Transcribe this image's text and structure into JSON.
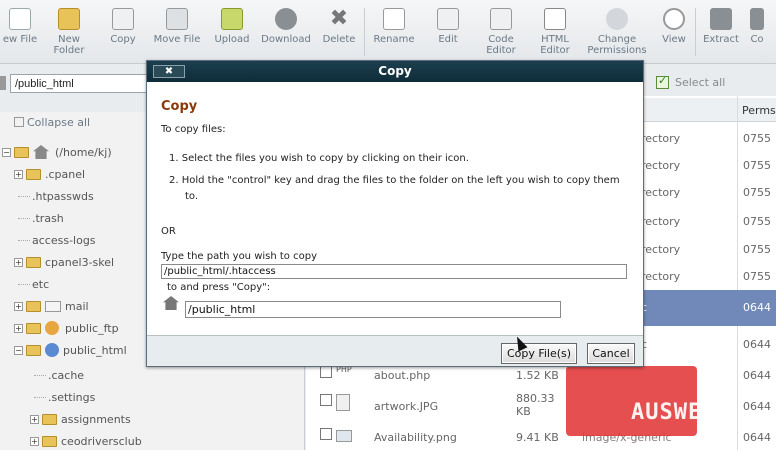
{
  "toolbar": {
    "buttons": [
      {
        "label": "ew File",
        "icon": "new-file-icon"
      },
      {
        "label": "New\nFolder",
        "icon": "new-folder-icon"
      },
      {
        "label": "Copy",
        "icon": "copy-icon"
      },
      {
        "label": "Move File",
        "icon": "move-file-icon"
      },
      {
        "label": "Upload",
        "icon": "upload-icon"
      },
      {
        "label": "Download",
        "icon": "download-icon"
      },
      {
        "label": "Delete",
        "icon": "delete-icon"
      },
      {
        "label": "Rename",
        "icon": "rename-icon"
      },
      {
        "label": "Edit",
        "icon": "edit-icon"
      },
      {
        "label": "Code\nEditor",
        "icon": "code-editor-icon"
      },
      {
        "label": "HTML\nEditor",
        "icon": "html-editor-icon"
      },
      {
        "label": "Change\nPermissions",
        "icon": "permissions-icon"
      },
      {
        "label": "View",
        "icon": "view-icon"
      },
      {
        "label": "Extract",
        "icon": "extract-icon"
      },
      {
        "label": "Co",
        "icon": "compress-icon"
      }
    ]
  },
  "path": {
    "value": "/public_html"
  },
  "select_all": {
    "label": "Select all"
  },
  "tree": {
    "collapse_all": "Collapse all",
    "root": "(/home/kj)",
    "items": [
      ".cpanel",
      ".htpasswds",
      ".trash",
      "access-logs",
      "cpanel3-skel",
      "etc",
      "mail",
      "public_ftp",
      "public_html",
      ".cache",
      ".settings",
      "assignments",
      "ceodriversclub"
    ]
  },
  "list": {
    "perms_header": "Perms",
    "rows": [
      {
        "type": "rectory",
        "perms": "0755"
      },
      {
        "type": "rectory",
        "perms": "0755"
      },
      {
        "type": "rectory",
        "perms": "0755"
      },
      {
        "type": "rectory",
        "perms": "0755"
      },
      {
        "type": "rectory",
        "perms": "0755"
      },
      {
        "type": "rectory",
        "perms": "0755"
      },
      {
        "type": "c",
        "perms": "0644"
      },
      {
        "type": "c",
        "perms": "0644"
      },
      {
        "name": "about.php",
        "size": "1.52 KB",
        "perms": "0644"
      },
      {
        "name": "artwork.JPG",
        "size": "880.33\nKB",
        "perms": "0644"
      },
      {
        "name": "Availability.png",
        "size": "9.41 KB",
        "type": "image/x-generic",
        "perms": "0644"
      }
    ]
  },
  "modal": {
    "title": "Copy",
    "close_label": "✖",
    "heading": "Copy",
    "intro": "To copy files:",
    "step1": "1.  Select the files you wish to copy by clicking on their icon.",
    "step2a": "2.  Hold the \"control\" key and drag the files to the folder on the left you wish to copy them",
    "step2b": "to.",
    "or": "OR",
    "path_label": "Type the path you wish to copy",
    "source_value": "/public_html/.htaccess",
    "press_label": "to and press \"Copy\":",
    "dest_value": "/public_html",
    "copy_button": "Copy File(s)",
    "cancel_button": "Cancel"
  },
  "watermark": {
    "text": "AUSWEB"
  }
}
